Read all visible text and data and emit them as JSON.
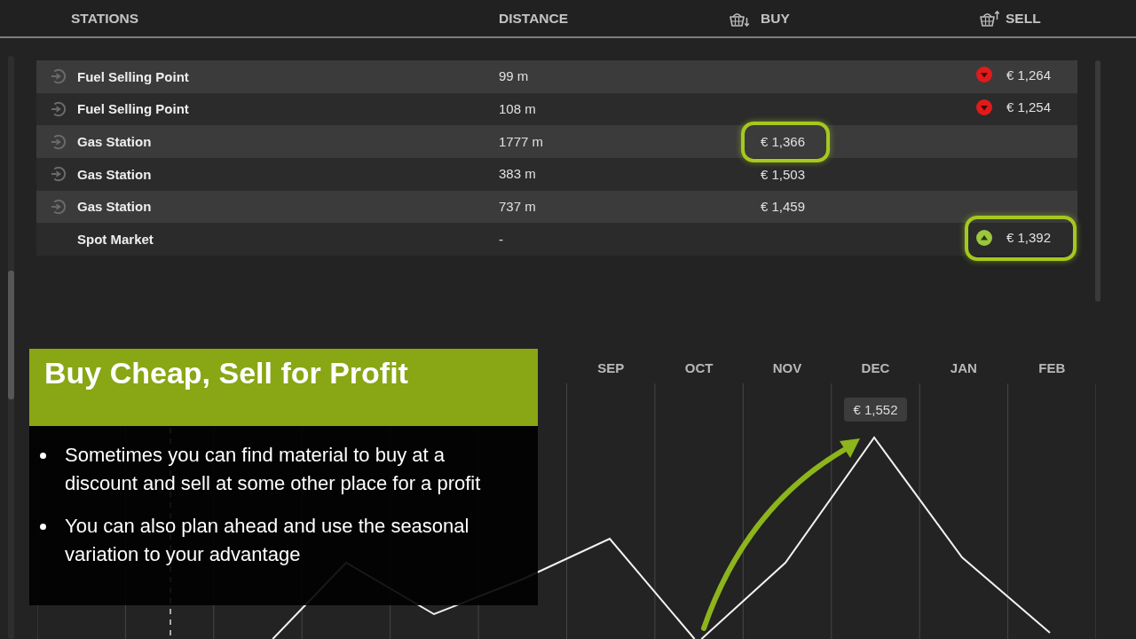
{
  "table": {
    "columns": [
      {
        "label": "STATIONS",
        "kind": "text"
      },
      {
        "label": "DISTANCE",
        "kind": "text"
      },
      {
        "label": "BUY",
        "kind": "buy"
      },
      {
        "label": "SELL",
        "kind": "sell"
      }
    ],
    "rows": [
      {
        "station": "Fuel Selling Point",
        "locate_icon": true,
        "distance": "99 m",
        "sell": {
          "price": "€ 1,264",
          "rising": false,
          "highlighted": false
        }
      },
      {
        "station": "Fuel Selling Point",
        "locate_icon": true,
        "distance": "108 m",
        "sell": {
          "price": "€ 1,254",
          "rising": false,
          "highlighted": false
        }
      },
      {
        "station": "Gas Station",
        "locate_icon": true,
        "distance": "1777 m",
        "buy": {
          "price": "€ 1,366",
          "highlighted": true
        }
      },
      {
        "station": "Gas Station",
        "locate_icon": true,
        "distance": "383 m",
        "buy": {
          "price": "€ 1,503",
          "highlighted": false
        }
      },
      {
        "station": "Gas Station",
        "locate_icon": true,
        "distance": "737 m",
        "buy": {
          "price": "€ 1,459",
          "highlighted": false
        }
      },
      {
        "station": "Spot Market",
        "locate_icon": false,
        "distance": "-",
        "sell": {
          "price": "€ 1,392",
          "rising": true,
          "highlighted": true
        }
      }
    ]
  },
  "price_chart": {
    "months": [
      {
        "label": "SEP"
      },
      {
        "label": "OCT"
      },
      {
        "label": "NOV"
      },
      {
        "label": "DEC",
        "tooltip": "€ 1,552"
      },
      {
        "label": "JAN"
      },
      {
        "label": "FEB"
      }
    ]
  },
  "info_box": {
    "title": "Buy Cheap, Sell for Profit",
    "bullets": [
      "Sometimes you can find material to buy at a discount and sell at some other place for a profit",
      "You can also plan ahead and use the seasonal variation to your advantage"
    ]
  }
}
